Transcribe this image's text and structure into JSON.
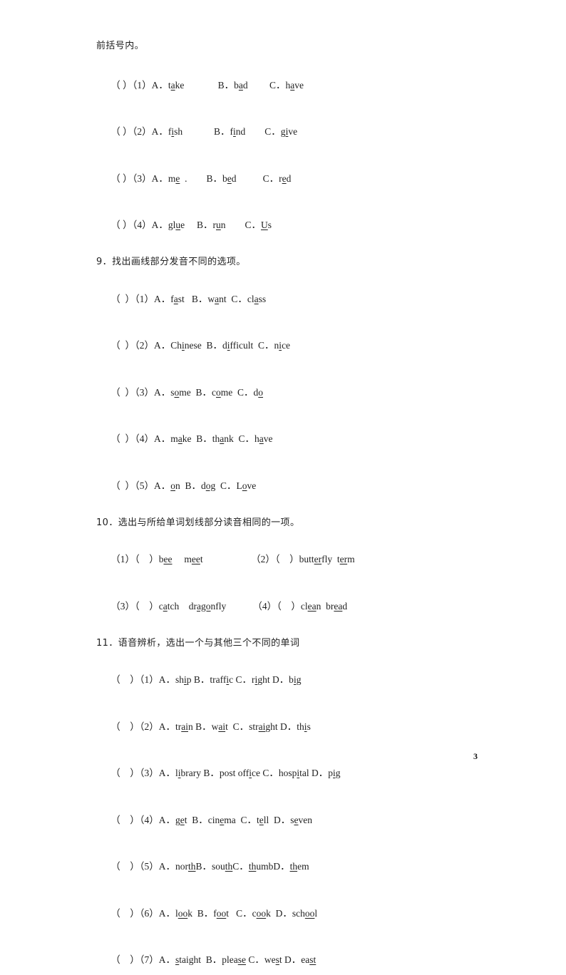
{
  "page": {
    "page_number": "3",
    "intro_line": "前括号内。"
  },
  "sections": [
    {
      "id": "section-8-continued",
      "heading": "",
      "items": [
        {
          "label": "（ ）（1）",
          "content": "A．t<u>a</u>ke              B．b<u>a</u>d         C．h<u>a</u>ve"
        },
        {
          "label": "（ ）（2）",
          "content": "A．f<u>i</u>sh             B．f<u>i</u>nd        C．g<u>i</u>ve"
        },
        {
          "label": "（ ）（3）",
          "content": "A．m<u>e</u>  .        B．b<u>e</u>d           C．r<u>e</u>d"
        },
        {
          "label": "（ ）（4）",
          "content": "A．gl<u>u</u>e     B．r<u>u</u>n        C．<u>U</u>s"
        }
      ]
    },
    {
      "id": "section-9",
      "heading": "9．找出画线部分发音不同的选项。",
      "items": [
        {
          "label": "（  ）（1）",
          "content": "A．f<u>a</u>st   B．w<u>a</u>nt  C．cl<u>a</u>ss"
        },
        {
          "label": "（  ）（2）",
          "content": "A．Ch<u>i</u>nese  B．d<u>i</u>fficult  C．n<u>i</u>ce"
        },
        {
          "label": "（  ）（3）",
          "content": "A．s<u>o</u>me  B．c<u>o</u>me  C．d<u>o</u>"
        },
        {
          "label": "（  ）（4）",
          "content": "A．m<u>a</u>ke  B．th<u>a</u>nk  C．h<u>a</u>ve"
        },
        {
          "label": "（  ）（5）",
          "content": "A．<u>o</u>n  B．d<u>og</u>  C．L<u>o</u>ve"
        }
      ]
    },
    {
      "id": "section-10",
      "heading": "10．选出与所给单词划线部分读音相同的一项。",
      "items": [
        {
          "label": "（1）（    ）",
          "content": "b<u>ee</u>     m<u>ee</u>t                    （2）（    ）butt<u>er</u>fly  t<u>er</u>m"
        },
        {
          "label": "（3）（    ）",
          "content": "c<u>a</u>tch    dr<u>ago</u>nfly           （4）（    ）cl<u>ea</u>n  br<u>ea</u>d"
        }
      ]
    },
    {
      "id": "section-11",
      "heading": "11．语音辨析，选出一个与其他三个不同的单词",
      "items": [
        {
          "label": "（    ）（1）",
          "content": "A．sh<u>i</u>p B．traff<u>i</u>c C．r<u>i</u>ght D．b<u>ig</u>"
        },
        {
          "label": "（    ）（2）",
          "content": "A．tr<u>ai</u>n B．w<u>ai</u>t  C．str<u>ai</u>ght D．th<u>i</u>s"
        },
        {
          "label": "（    ）（3）",
          "content": "A．l<u>i</u>brary B．post off<u>i</u>ce C．hosp<u>i</u>tal D．p<u>ig</u>"
        },
        {
          "label": "（    ）（4）",
          "content": "A．g<u>e</u>t  B．cin<u>e</u>ma  C．t<u>e</u>ll  D．s<u>e</u>ven"
        },
        {
          "label": "（    ）（5）",
          "content": "A．nor<u>th</u>B．sou<u>th</u>C．<u>th</u>umbD．<u>th</u>em"
        },
        {
          "label": "（    ）（6）",
          "content": "A．l<u>oo</u>k  B．f<u>oo</u>t   C．c<u>oo</u>k  D．sch<u>oo</u>l"
        },
        {
          "label": "（    ）（7）",
          "content": "A．<u>s</u>taight  B．plea<u>se</u> C．we<u>s</u>t D．ea<u>st</u>"
        }
      ]
    }
  ]
}
